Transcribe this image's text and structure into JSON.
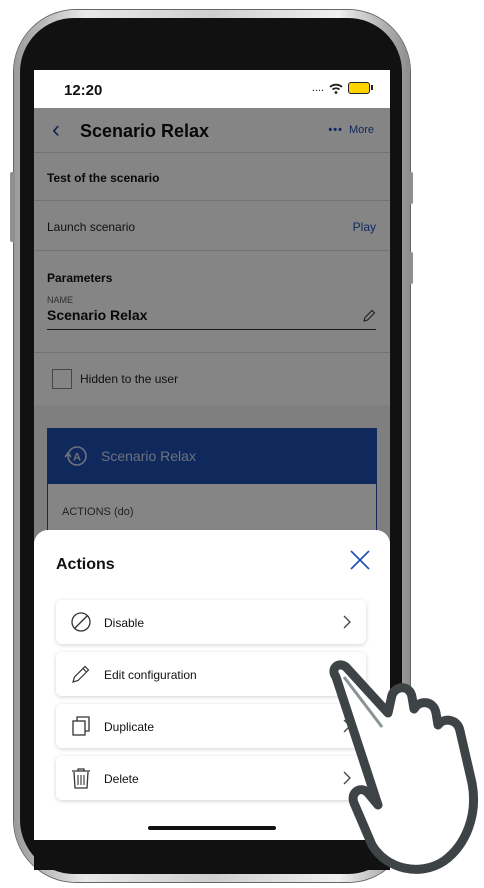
{
  "status_bar": {
    "time": "12:20",
    "signal": "....",
    "wifi_icon": "wifi-icon",
    "battery_icon": "battery-charging-icon"
  },
  "nav": {
    "back_icon": "chevron-left-icon",
    "title": "Scenario Relax",
    "more_label": "More",
    "more_dots": "•••"
  },
  "test_section": {
    "header": "Test of the scenario",
    "launch_label": "Launch scenario",
    "play_label": "Play"
  },
  "parameters": {
    "header": "Parameters",
    "name_label": "NAME",
    "name_value": "Scenario Relax",
    "hidden_label": "Hidden to the user"
  },
  "scenario_card": {
    "title": "Scenario Relax",
    "actions_label": "ACTIONS (do)"
  },
  "sheet": {
    "title": "Actions",
    "items": [
      {
        "label": "Disable",
        "icon": "disable-icon"
      },
      {
        "label": "Edit configuration",
        "icon": "pencil-icon"
      },
      {
        "label": "Duplicate",
        "icon": "duplicate-icon"
      },
      {
        "label": "Delete",
        "icon": "trash-icon"
      }
    ]
  },
  "colors": {
    "accent": "#1f4fb3",
    "overlay": "#000000"
  }
}
